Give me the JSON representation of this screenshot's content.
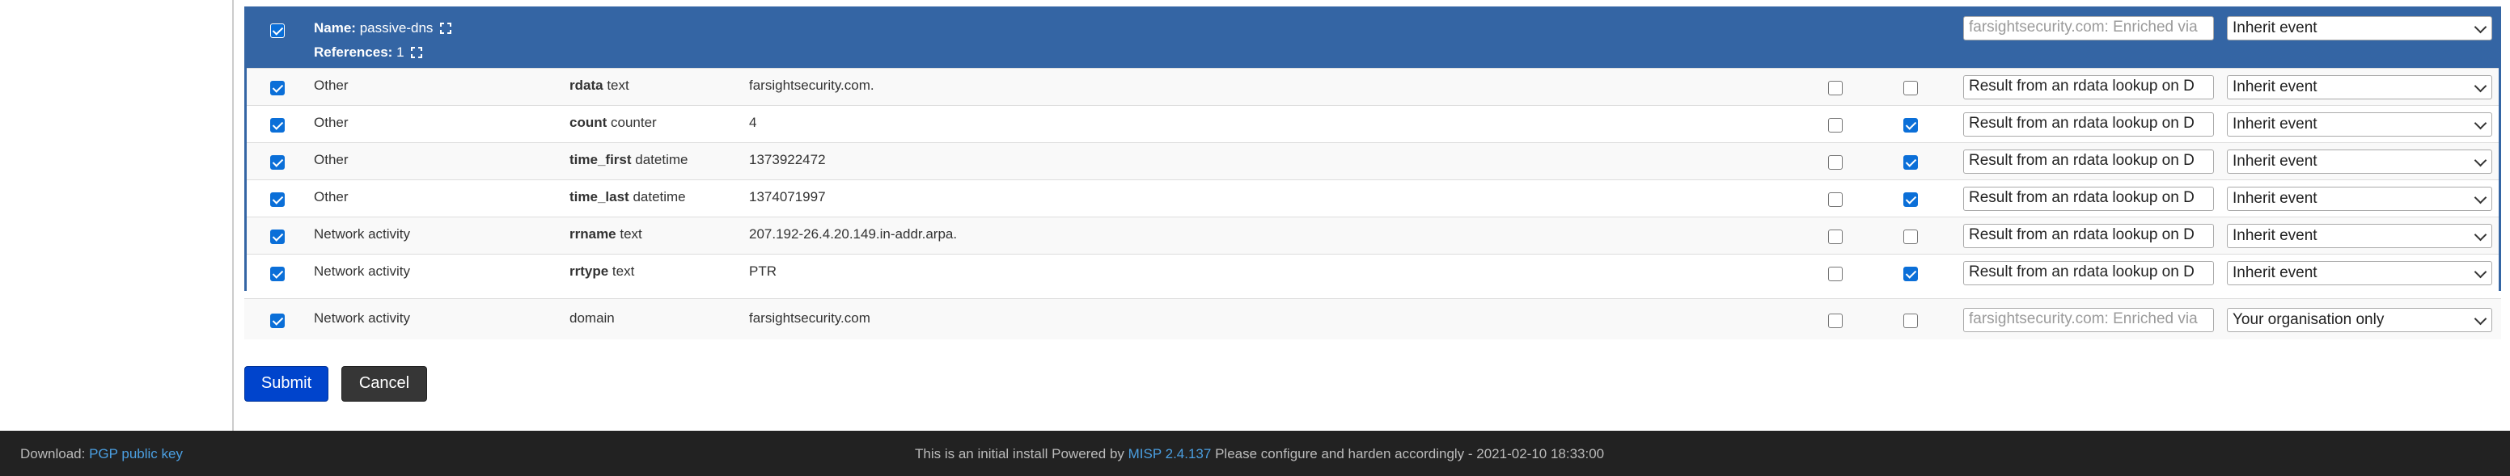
{
  "object": {
    "name_label": "Name:",
    "name_value": "passive-dns",
    "references_label": "References:",
    "references_value": "1",
    "header_comment_placeholder": "farsightsecurity.com: Enriched via",
    "header_distribution": "Inherit event",
    "header_checked": true
  },
  "rows": [
    {
      "category": "Other",
      "relation": "rdata",
      "type": "text",
      "value": "farsightsecurity.com.",
      "ids": false,
      "disable_correlation": false,
      "comment": "Result from an rdata lookup on D",
      "distribution": "Inherit event",
      "checked": true
    },
    {
      "category": "Other",
      "relation": "count",
      "type": "counter",
      "value": "4",
      "ids": false,
      "disable_correlation": true,
      "comment": "Result from an rdata lookup on D",
      "distribution": "Inherit event",
      "checked": true
    },
    {
      "category": "Other",
      "relation": "time_first",
      "type": "datetime",
      "value": "1373922472",
      "ids": false,
      "disable_correlation": true,
      "comment": "Result from an rdata lookup on D",
      "distribution": "Inherit event",
      "checked": true
    },
    {
      "category": "Other",
      "relation": "time_last",
      "type": "datetime",
      "value": "1374071997",
      "ids": false,
      "disable_correlation": true,
      "comment": "Result from an rdata lookup on D",
      "distribution": "Inherit event",
      "checked": true
    },
    {
      "category": "Network activity",
      "relation": "rrname",
      "type": "text",
      "value": "207.192-26.4.20.149.in-addr.arpa.",
      "ids": false,
      "disable_correlation": false,
      "comment": "Result from an rdata lookup on D",
      "distribution": "Inherit event",
      "checked": true
    },
    {
      "category": "Network activity",
      "relation": "rrtype",
      "type": "text",
      "value": "PTR",
      "ids": false,
      "disable_correlation": true,
      "comment": "Result from an rdata lookup on D",
      "distribution": "Inherit event",
      "checked": true
    }
  ],
  "standalone": {
    "category": "Network activity",
    "type": "domain",
    "value": "farsightsecurity.com",
    "ids": false,
    "disable_correlation": false,
    "comment_placeholder": "farsightsecurity.com: Enriched via",
    "distribution": "Your organisation only",
    "checked": true
  },
  "actions": {
    "submit_label": "Submit",
    "cancel_label": "Cancel"
  },
  "footer": {
    "download_label": "Download:",
    "pgp_link": "PGP public key",
    "notice_prefix": "This is an initial install Powered by",
    "misp_link": "MISP 2.4.137",
    "notice_suffix": "Please configure and harden accordingly - 2021-02-10 18:33:00"
  },
  "colors": {
    "header_blue": "#3465a4",
    "checkbox_blue": "#0b6fd8",
    "submit_blue": "#0044cc",
    "footer_bg": "#222222",
    "link": "#4b9fe1"
  }
}
